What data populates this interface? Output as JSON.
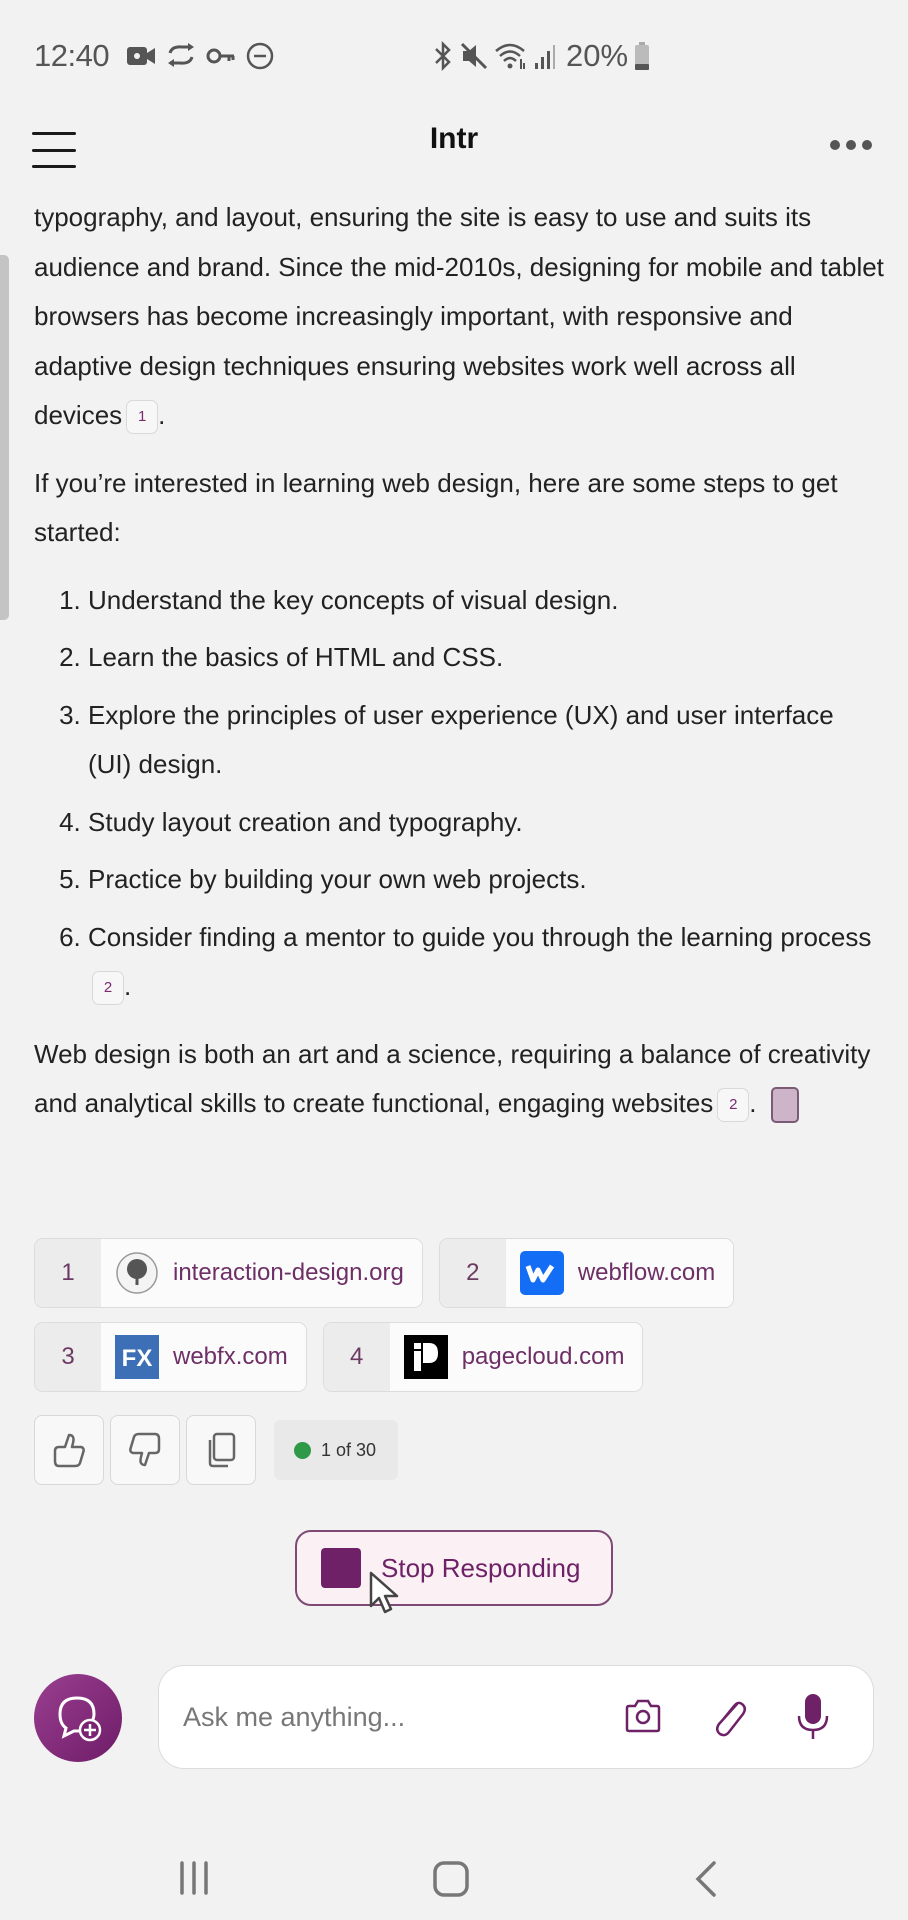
{
  "status_bar": {
    "time": "12:40",
    "battery_percent": "20%",
    "left_icons": [
      "video-call-icon",
      "sync-icon",
      "vpn-key-icon",
      "do-not-disturb-icon"
    ],
    "right_icons": [
      "bluetooth-icon",
      "mute-icon",
      "wifi-icon",
      "signal-icon",
      "battery-icon"
    ]
  },
  "header": {
    "title": "Intr",
    "menu_icon": "hamburger-menu-icon",
    "more_icon": "more-options-icon"
  },
  "message": {
    "paragraph1": "typography, and layout, ensuring the site is easy to use and suits its audience and brand. Since the mid-2010s, designing for mobile and tablet browsers has become increasingly important, with responsive and adaptive design techniques ensuring websites work well across all devices",
    "paragraph1_cite": "1",
    "paragraph2": "If you’re interested in learning web design, here are some steps to get started:",
    "steps": [
      "Understand the key concepts of visual design.",
      "Learn the basics of HTML and CSS.",
      "Explore the principles of user experience (UX) and user interface (UI) design.",
      "Study layout creation and typography.",
      "Practice by building your own web projects.",
      "Consider finding a mentor to guide you through the learning process"
    ],
    "step6_cite": "2",
    "paragraph3": "Web design is both an art and a science, requiring a balance of creativity and analytical skills to create functional, engaging websites",
    "paragraph3_cite": "2"
  },
  "sources": [
    {
      "num": "1",
      "label": "interaction-design.org",
      "icon": "interaction-design-logo"
    },
    {
      "num": "2",
      "label": "webflow.com",
      "icon": "webflow-logo"
    },
    {
      "num": "3",
      "label": "webfx.com",
      "icon": "webfx-logo"
    },
    {
      "num": "4",
      "label": "pagecloud.com",
      "icon": "pagecloud-logo"
    }
  ],
  "actions": {
    "counter": "1 of 30",
    "status_color": "#2e9a48"
  },
  "stop_button": {
    "label": "Stop Responding"
  },
  "composer": {
    "placeholder": "Ask me anything...",
    "value": ""
  },
  "colors": {
    "accent": "#6e2167",
    "background": "#f2f2f2"
  }
}
